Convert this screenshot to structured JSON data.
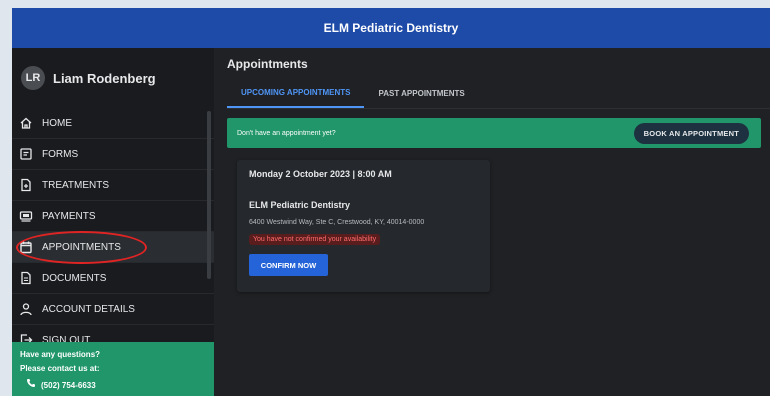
{
  "header": {
    "title": "ELM Pediatric Dentistry"
  },
  "sidebar": {
    "user": {
      "initials": "LR",
      "name": "Liam Rodenberg"
    },
    "items": [
      {
        "label": "HOME",
        "icon": "home-icon"
      },
      {
        "label": "FORMS",
        "icon": "forms-icon"
      },
      {
        "label": "TREATMENTS",
        "icon": "treatments-icon"
      },
      {
        "label": "PAYMENTS",
        "icon": "payments-icon"
      },
      {
        "label": "APPOINTMENTS",
        "icon": "calendar-icon",
        "active": true
      },
      {
        "label": "DOCUMENTS",
        "icon": "document-icon"
      },
      {
        "label": "ACCOUNT DETAILS",
        "icon": "person-icon"
      },
      {
        "label": "SIGN OUT",
        "icon": "sign-out-icon"
      }
    ],
    "help": {
      "line1": "Have any questions?",
      "line2": "Please contact us at:",
      "phone": "(502) 754-6633"
    }
  },
  "main": {
    "title": "Appointments",
    "tabs": [
      {
        "label": "UPCOMING APPOINTMENTS",
        "active": true
      },
      {
        "label": "PAST APPOINTMENTS",
        "active": false
      }
    ],
    "banner": {
      "text": "Don't have an appointment yet?",
      "button": "BOOK AN APPOINTMENT"
    },
    "appointment": {
      "datetime": "Monday 2 October 2023 | 8:00 AM",
      "clinic": "ELM Pediatric Dentistry",
      "address": "6400 Westwind Way, Ste C, Crestwood, KY, 40014-0000",
      "warning": "You have not confirmed your availability",
      "confirm_label": "CONFIRM NOW"
    }
  },
  "colors": {
    "header": "#1e4aa8",
    "accent_green": "#20966a",
    "tab_active": "#4f95f6",
    "confirm_button": "#2564d8",
    "warning_text": "#ff6b6b",
    "annotation": "#e02424"
  }
}
